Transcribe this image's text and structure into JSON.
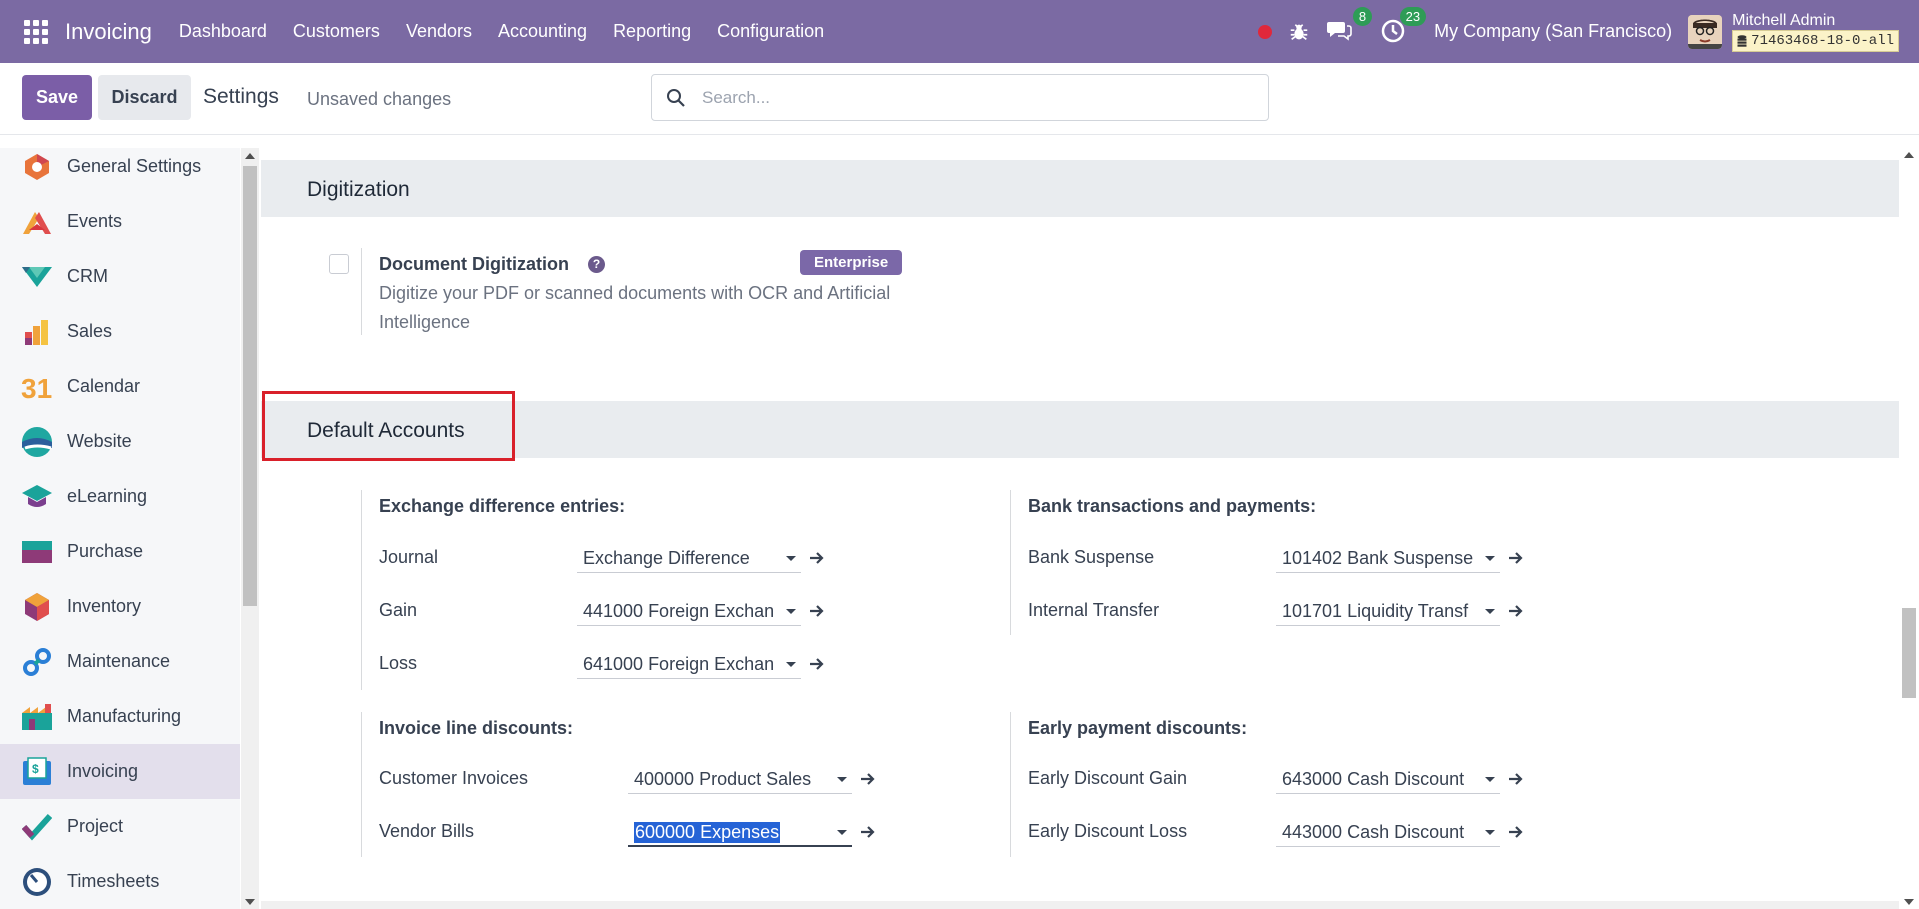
{
  "navbar": {
    "app_name": "Invoicing",
    "menu": [
      "Dashboard",
      "Customers",
      "Vendors",
      "Accounting",
      "Reporting",
      "Configuration"
    ],
    "messages_count": "8",
    "activities_count": "23",
    "company": "My Company (San Francisco)",
    "user_name": "Mitchell Admin",
    "database": "71463468-18-0-all",
    "bg_color": "#7b6aa3"
  },
  "control_panel": {
    "save_label": "Save",
    "discard_label": "Discard",
    "title": "Settings",
    "status": "Unsaved changes",
    "search_placeholder": "Search..."
  },
  "sidebar": {
    "items": [
      {
        "label": "General Settings",
        "icon": "general-settings-icon"
      },
      {
        "label": "Events",
        "icon": "events-icon"
      },
      {
        "label": "CRM",
        "icon": "crm-icon"
      },
      {
        "label": "Sales",
        "icon": "sales-icon"
      },
      {
        "label": "Calendar",
        "icon": "calendar-icon"
      },
      {
        "label": "Website",
        "icon": "website-icon"
      },
      {
        "label": "eLearning",
        "icon": "elearning-icon"
      },
      {
        "label": "Purchase",
        "icon": "purchase-icon"
      },
      {
        "label": "Inventory",
        "icon": "inventory-icon"
      },
      {
        "label": "Maintenance",
        "icon": "maintenance-icon"
      },
      {
        "label": "Manufacturing",
        "icon": "manufacturing-icon"
      },
      {
        "label": "Invoicing",
        "icon": "invoicing-icon",
        "active": true
      },
      {
        "label": "Project",
        "icon": "project-icon"
      },
      {
        "label": "Timesheets",
        "icon": "timesheets-icon"
      }
    ],
    "calendar_icon_text": "31"
  },
  "digitization": {
    "section_title": "Digitization",
    "setting_title": "Document Digitization",
    "badge": "Enterprise",
    "description_line1": "Digitize your PDF or scanned documents with OCR and Artificial",
    "description_line2": "Intelligence",
    "checked": false
  },
  "default_accounts": {
    "section_title": "Default Accounts",
    "exchange": {
      "title": "Exchange difference entries:",
      "journal_label": "Journal",
      "journal_value": "Exchange Difference",
      "gain_label": "Gain",
      "gain_value": "441000 Foreign Exchan",
      "loss_label": "Loss",
      "loss_value": "641000 Foreign Exchan"
    },
    "bank": {
      "title": "Bank transactions and payments:",
      "suspense_label": "Bank Suspense",
      "suspense_value": "101402 Bank Suspense",
      "transfer_label": "Internal Transfer",
      "transfer_value": "101701 Liquidity Transf"
    },
    "invoice_discounts": {
      "title": "Invoice line discounts:",
      "customer_label": "Customer Invoices",
      "customer_value": "400000 Product Sales",
      "vendor_label": "Vendor Bills",
      "vendor_value": "600000 Expenses"
    },
    "early_payment": {
      "title": "Early payment discounts:",
      "gain_label": "Early Discount Gain",
      "gain_value": "643000 Cash Discount",
      "loss_label": "Early Discount Loss",
      "loss_value": "443000 Cash Discount"
    }
  }
}
